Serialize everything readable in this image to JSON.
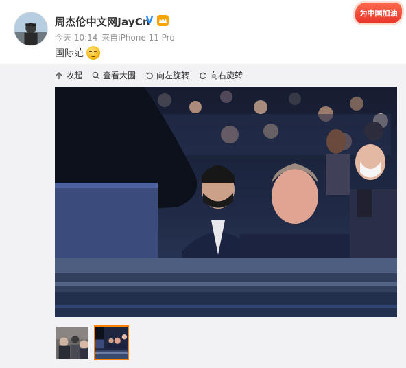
{
  "post": {
    "author": "周杰伦中文网JayCn",
    "meta_time": "今天 10:14",
    "meta_source": "来自iPhone 11 Pro",
    "text": "国际范"
  },
  "promo_badge": "为中国加油",
  "icons": {
    "verified": "verified-v-icon",
    "vip": "vip-crown-icon",
    "emoji": "smirk-emoji-icon"
  },
  "toolbar": {
    "collapse": "收起",
    "view_large": "查看大圖",
    "rotate_left": "向左旋转",
    "rotate_right": "向右旋转"
  },
  "thumbnails": [
    {
      "label": "thumbnail-1",
      "active": false
    },
    {
      "label": "thumbnail-2",
      "active": true
    }
  ],
  "colors": {
    "accent_active": "#ff8200",
    "verified_blue": "#2d8ff0",
    "meta_gray": "#939393",
    "panel_bg": "#f2f2f5"
  }
}
